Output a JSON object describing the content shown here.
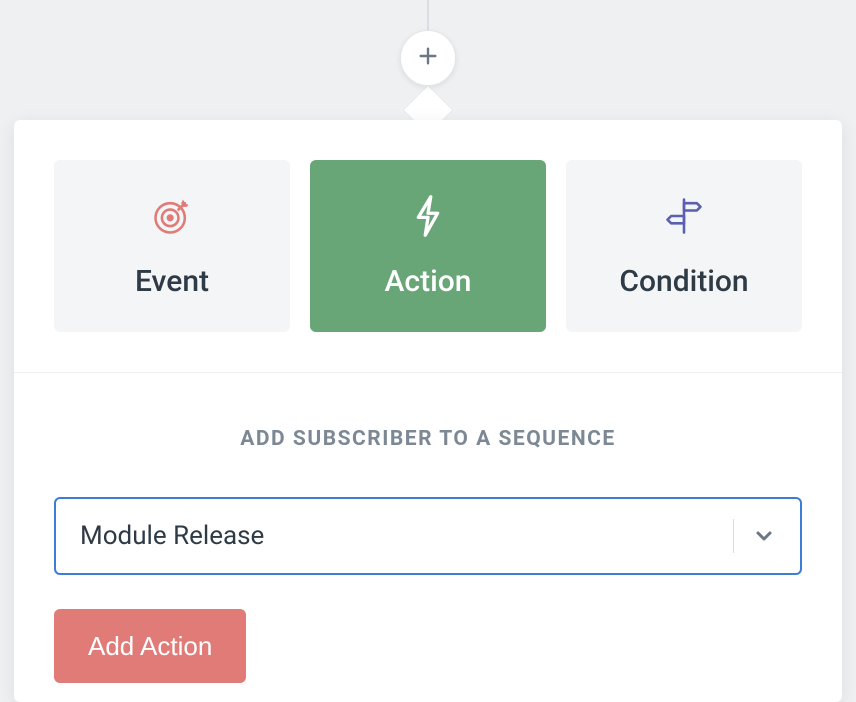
{
  "tabs": {
    "event": {
      "label": "Event"
    },
    "action": {
      "label": "Action"
    },
    "condition": {
      "label": "Condition"
    }
  },
  "form": {
    "title": "ADD SUBSCRIBER TO A SEQUENCE",
    "select_value": "Module Release",
    "submit_label": "Add Action"
  },
  "colors": {
    "accent_green": "#68a678",
    "accent_red": "#e07b78",
    "focus_blue": "#3b7dd8",
    "icon_red": "#e07b78",
    "icon_indigo": "#5a5fb0"
  }
}
